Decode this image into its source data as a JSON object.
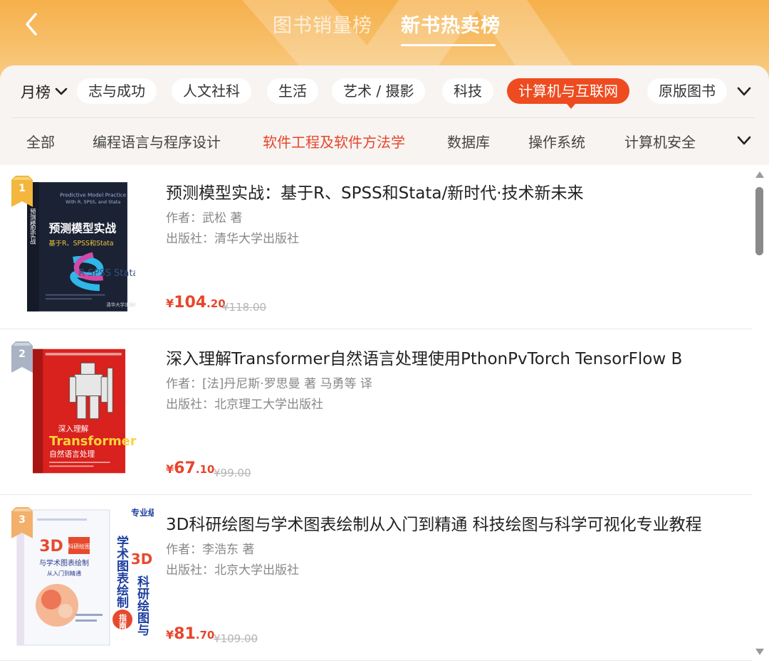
{
  "header": {
    "tabs": [
      {
        "label": "图书销量榜"
      },
      {
        "label": "新书热卖榜"
      }
    ],
    "active_tab": "新书热卖榜",
    "back_icon": "chevron-left-icon",
    "gradient_colors": [
      "#f6b04b",
      "#f8cd86"
    ]
  },
  "filters": {
    "period_label": "月榜",
    "categories": [
      {
        "label": "志与成功"
      },
      {
        "label": "人文社科"
      },
      {
        "label": "生活"
      },
      {
        "label": "艺术 / 摄影"
      },
      {
        "label": "科技"
      },
      {
        "label": "计算机与互联网"
      },
      {
        "label": "原版图书"
      }
    ],
    "active_category": "计算机与互联网",
    "subcategories": [
      {
        "label": "全部"
      },
      {
        "label": "编程语言与程序设计"
      },
      {
        "label": "软件工程及软件方法学"
      },
      {
        "label": "数据库"
      },
      {
        "label": "操作系统"
      },
      {
        "label": "计算机安全"
      }
    ],
    "active_subcategory": "软件工程及软件方法学",
    "accent_color": "#ee4b20"
  },
  "books": [
    {
      "rank": "1",
      "title": "预测模型实战：基于R、SPSS和Stata/新时代·技术新未来",
      "author": "作者：武松 著",
      "publisher": "出版社：清华大学出版社",
      "price_symbol": "¥",
      "price_int": "104",
      "price_dec": ".20",
      "orig_price": "¥118.00",
      "cover": {
        "top_small": "Predictive Model Practice With R, SPSS, and Stata",
        "main": "预测模型实战",
        "sub": "基于R、SPSS和Stata",
        "spine": "预测模型实战",
        "watermark": "R SPSS Stata",
        "publisher_mark": "清华大学出版社"
      }
    },
    {
      "rank": "2",
      "title": "深入理解Transformer自然语言处理使用PthonPvTorch TensorFlow B",
      "author": "作者：[法]丹尼斯·罗思曼 著 马勇等 译",
      "publisher": "出版社：北京理工大学出版社",
      "price_symbol": "¥",
      "price_int": "67",
      "price_dec": ".10",
      "orig_price": "¥99.00",
      "cover": {
        "pre": "深入理解",
        "main": "Transformer",
        "sub": "自然语言处理"
      }
    },
    {
      "rank": "3",
      "title": "3D科研绘图与学术图表绘制从入门到精通 科技绘图与科学可视化专业教程",
      "author": "作者：李浩东 著",
      "publisher": "出版社：北京大学出版社",
      "price_symbol": "¥",
      "price_int": "81",
      "price_dec": ".70",
      "orig_price": "¥109.00",
      "cover": {
        "main": "3D",
        "main_box": "科研绘图",
        "sub": "与学术图表绘制",
        "sub2": "从入门到精通",
        "side_badge": "专业级",
        "side_col1": "学术图表绘制",
        "side_big": "3D",
        "side_col2": "科研绘图与",
        "side_guide": "指南"
      }
    }
  ],
  "colors": {
    "price": "#e8452b",
    "gold_badge": "#f2b73c",
    "silver_badge": "#a9b3c3",
    "bronze_badge": "#f2b06a"
  }
}
